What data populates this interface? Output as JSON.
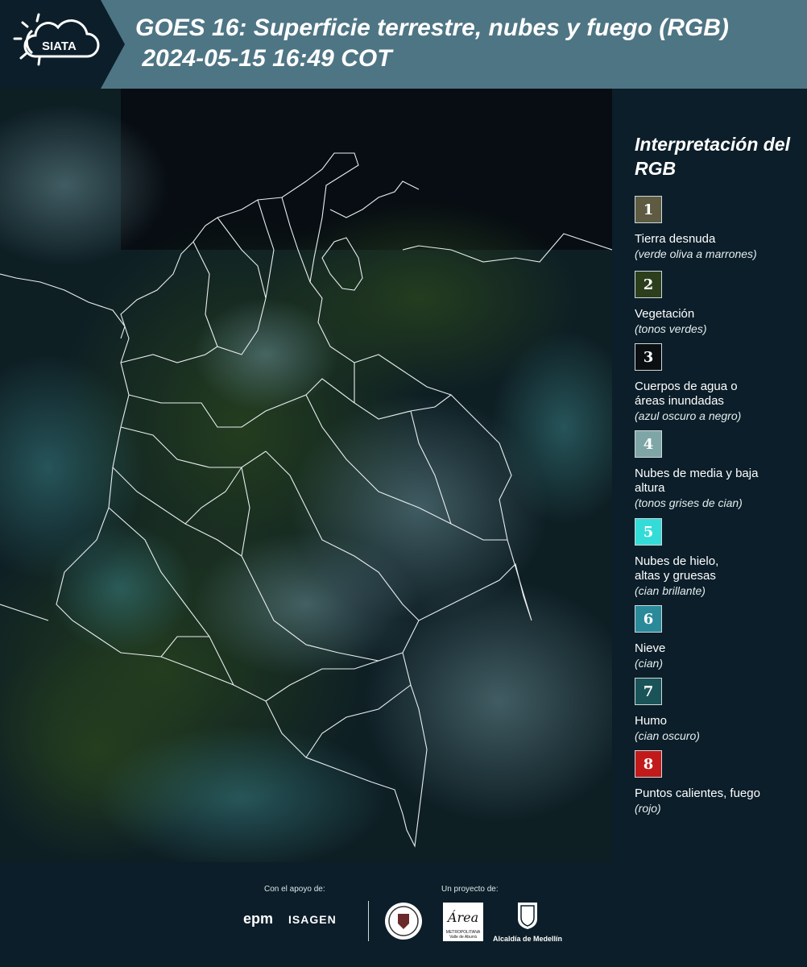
{
  "header": {
    "logo_text": "SIATA",
    "title": "GOES 16: Superficie terrestre, nubes y fuego (RGB)\n 2024-05-15 16:49 COT"
  },
  "legend": {
    "title": "Interpretación del RGB",
    "items": [
      {
        "num": "1",
        "label": "Tierra desnuda",
        "desc": "(verde oliva a marrones)",
        "color": "#5e5b42"
      },
      {
        "num": "2",
        "label": "Vegetación",
        "desc": "(tonos verdes)",
        "color": "#2c3f1d"
      },
      {
        "num": "3",
        "label": "Cuerpos de agua o áreas inundadas",
        "desc": "(azul oscuro a negro)",
        "color": "#0c0f12"
      },
      {
        "num": "4",
        "label": "Nubes de media y baja altura",
        "desc": "(tonos grises de cian)",
        "color": "#7fa6a6"
      },
      {
        "num": "5",
        "label": "Nubes de hielo, altas y gruesas",
        "desc": "(cian brillante)",
        "color": "#33dcd8"
      },
      {
        "num": "6",
        "label": "Nieve",
        "desc": "(cian)",
        "color": "#2a8a9a"
      },
      {
        "num": "7",
        "label": "Humo",
        "desc": "(cian oscuro)",
        "color": "#1b5458"
      },
      {
        "num": "8",
        "label": "Puntos calientes, fuego",
        "desc": "(rojo)",
        "color": "#c21a1a"
      }
    ]
  },
  "footer": {
    "support_label": "Con el apoyo de:",
    "project_label": "Un proyecto de:",
    "sponsor_1": "epm",
    "sponsor_2": "ISAGEN",
    "partner_1": "Área",
    "partner_1_sub": "METROPOLITANA Valle de Aburrá",
    "partner_2": "Alcaldía de Medellín"
  }
}
